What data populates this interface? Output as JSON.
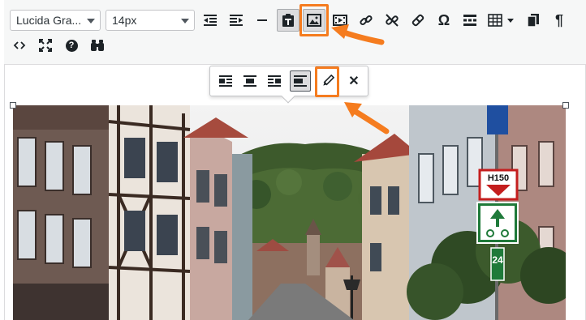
{
  "toolbar": {
    "font_family": {
      "value": "Lucida Gra..."
    },
    "font_size": {
      "value": "14px"
    },
    "row1_icons": [
      "indent-decrease-icon",
      "indent-increase-icon",
      "horizontal-line-icon",
      "paste-as-text-icon",
      "insert-image-icon",
      "insert-media-icon",
      "insert-link-icon",
      "remove-link-icon",
      "clear-formatting-icon",
      "special-character-icon",
      "read-more-icon",
      "table-icon",
      "copy-icon",
      "paragraph-icon"
    ],
    "row2_icons": [
      "code-icon",
      "fullscreen-icon",
      "help-icon",
      "find-icon"
    ],
    "omega": "Ω",
    "pilcrow": "¶",
    "help": "?"
  },
  "image_toolbar": {
    "icons": [
      "align-left-icon",
      "align-center-icon",
      "align-right-icon",
      "align-none-icon",
      "edit-icon",
      "remove-icon"
    ],
    "remove_glyph": "✕"
  },
  "image": {
    "description": "street-photo",
    "signs": {
      "top": "H150",
      "bottom": "24"
    }
  },
  "colors": {
    "highlight": "#f57c1f",
    "toolbar_bg": "#f6f7f7",
    "border": "#dcdcde"
  }
}
